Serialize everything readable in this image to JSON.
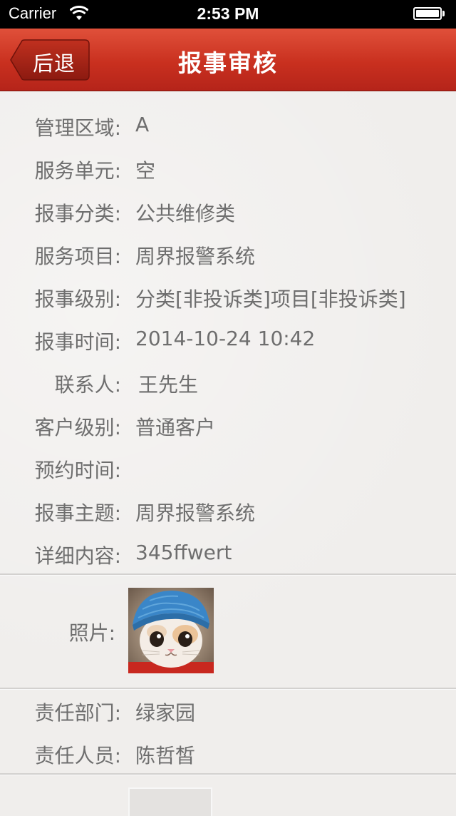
{
  "status_bar": {
    "carrier": "Carrier",
    "time": "2:53 PM"
  },
  "nav": {
    "back_label": "后退",
    "title": "报事审核"
  },
  "fields": [
    {
      "label": "管理区域:",
      "value": "A"
    },
    {
      "label": "服务单元:",
      "value": "空"
    },
    {
      "label": "报事分类:",
      "value": "公共维修类"
    },
    {
      "label": "服务项目:",
      "value": "周界报警系统"
    },
    {
      "label": "报事级别:",
      "value": "分类[非投诉类]项目[非投诉类]"
    },
    {
      "label": "报事时间:",
      "value": "2014-10-24 10:42"
    },
    {
      "label": "联系人:",
      "value": "王先生"
    },
    {
      "label": "客户级别:",
      "value": "普通客户"
    },
    {
      "label": "预约时间:",
      "value": ""
    },
    {
      "label": "报事主题:",
      "value": "周界报警系统"
    },
    {
      "label": "详细内容:",
      "value": "345ffwert"
    }
  ],
  "photo": {
    "label": "照片:"
  },
  "responsibility": [
    {
      "label": "责任部门:",
      "value": "绿家园"
    },
    {
      "label": "责任人员:",
      "value": "陈哲皙"
    }
  ],
  "colors": {
    "nav_red": "#c9301f",
    "text_gray": "#6e6e6e",
    "background": "#f0eeec"
  }
}
